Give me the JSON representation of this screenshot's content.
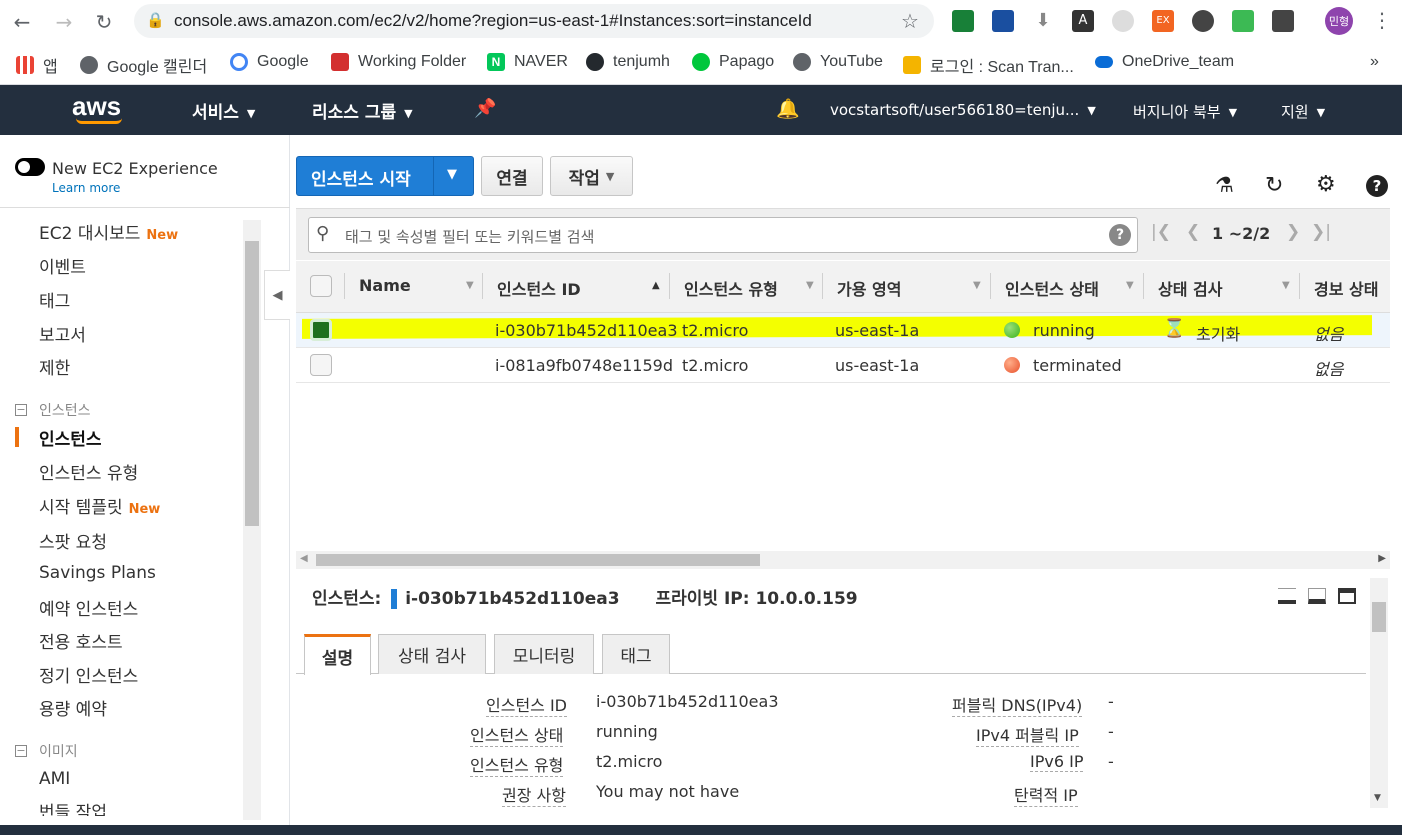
{
  "browser": {
    "url": "console.aws.amazon.com/ec2/v2/home?region=us-east-1#Instances:sort=instanceId",
    "profile_initials": "민형",
    "bookmarks": [
      {
        "label": "앱",
        "color": "#4285f4"
      },
      {
        "label": "Google 캘린더",
        "color": "#5f6368"
      },
      {
        "label": "Google",
        "color": "#4285f4"
      },
      {
        "label": "Working Folder",
        "color": "#d32f2f"
      },
      {
        "label": "NAVER",
        "color": "#03c75a"
      },
      {
        "label": "tenjumh",
        "color": "#24292e"
      },
      {
        "label": "Papago",
        "color": "#00c73c"
      },
      {
        "label": "YouTube",
        "color": "#5f6368"
      },
      {
        "label": "로그인 : Scan Tran...",
        "color": "#f4b400"
      },
      {
        "label": "OneDrive_team",
        "color": "#0a6cd6"
      }
    ],
    "more_bookmarks": "»"
  },
  "awsnav": {
    "logo": "aws",
    "services": "서비스",
    "resource_groups": "리소스 그룹",
    "account": "vocstartsoft/user566180=tenju...",
    "region": "버지니아 북부",
    "support": "지원"
  },
  "sidebar": {
    "toggle_label": "New EC2 Experience",
    "learn_more": "Learn more",
    "new_tag": "New",
    "items_top": [
      "EC2 대시보드",
      "이벤트",
      "태그",
      "보고서",
      "제한"
    ],
    "group_instances": "인스턴스",
    "items_instances": [
      "인스턴스",
      "인스턴스 유형",
      "시작 템플릿",
      "스팟 요청",
      "Savings Plans",
      "예약 인스턴스",
      "전용 호스트",
      "정기 인스턴스",
      "용량 예약"
    ],
    "group_images": "이미지",
    "items_images": [
      "AMI",
      "번들 작업"
    ]
  },
  "toolbar": {
    "launch": "인스턴스 시작",
    "connect": "연결",
    "actions": "작업"
  },
  "search": {
    "placeholder": "태그 및 속성별 필터 또는 키워드별 검색",
    "pagination": "1 ~2/2"
  },
  "table": {
    "columns": [
      "Name",
      "인스턴스 ID",
      "인스턴스 유형",
      "가용 영역",
      "인스턴스 상태",
      "상태 검사",
      "경보 상태"
    ],
    "rows": [
      {
        "name": "",
        "id": "i-030b71b452d110ea3",
        "type": "t2.micro",
        "az": "us-east-1a",
        "state": "running",
        "state_color": "#3bb31a",
        "check": "초기화",
        "alarm": "없음",
        "selected": true
      },
      {
        "name": "",
        "id": "i-081a9fb0748e1159d",
        "type": "t2.micro",
        "az": "us-east-1a",
        "state": "terminated",
        "state_color": "#e8502a",
        "check": "",
        "alarm": "없음",
        "selected": false
      }
    ]
  },
  "details": {
    "instance_label": "인스턴스:",
    "instance_id": "i-030b71b452d110ea3",
    "private_ip_label": "프라이빗 IP:",
    "private_ip": "10.0.0.159",
    "tabs": [
      "설명",
      "상태 검사",
      "모니터링",
      "태그"
    ],
    "left_fields": [
      {
        "label": "인스턴스 ID",
        "value": "i-030b71b452d110ea3"
      },
      {
        "label": "인스턴스 상태",
        "value": "running"
      },
      {
        "label": "인스턴스 유형",
        "value": "t2.micro"
      },
      {
        "label": "권장 사항",
        "value": "You may not have"
      }
    ],
    "right_fields": [
      {
        "label": "퍼블릭 DNS(IPv4)",
        "value": "-"
      },
      {
        "label": "IPv4 퍼블릭 IP",
        "value": "-"
      },
      {
        "label": "IPv6 IP",
        "value": "-"
      },
      {
        "label": "탄력적 IP",
        "value": ""
      }
    ]
  },
  "colors": {
    "aws_nav": "#232f3e",
    "primary_button": "#1f7ed6",
    "highlight": "#f4ff00",
    "new_tag": "#ec7211"
  }
}
